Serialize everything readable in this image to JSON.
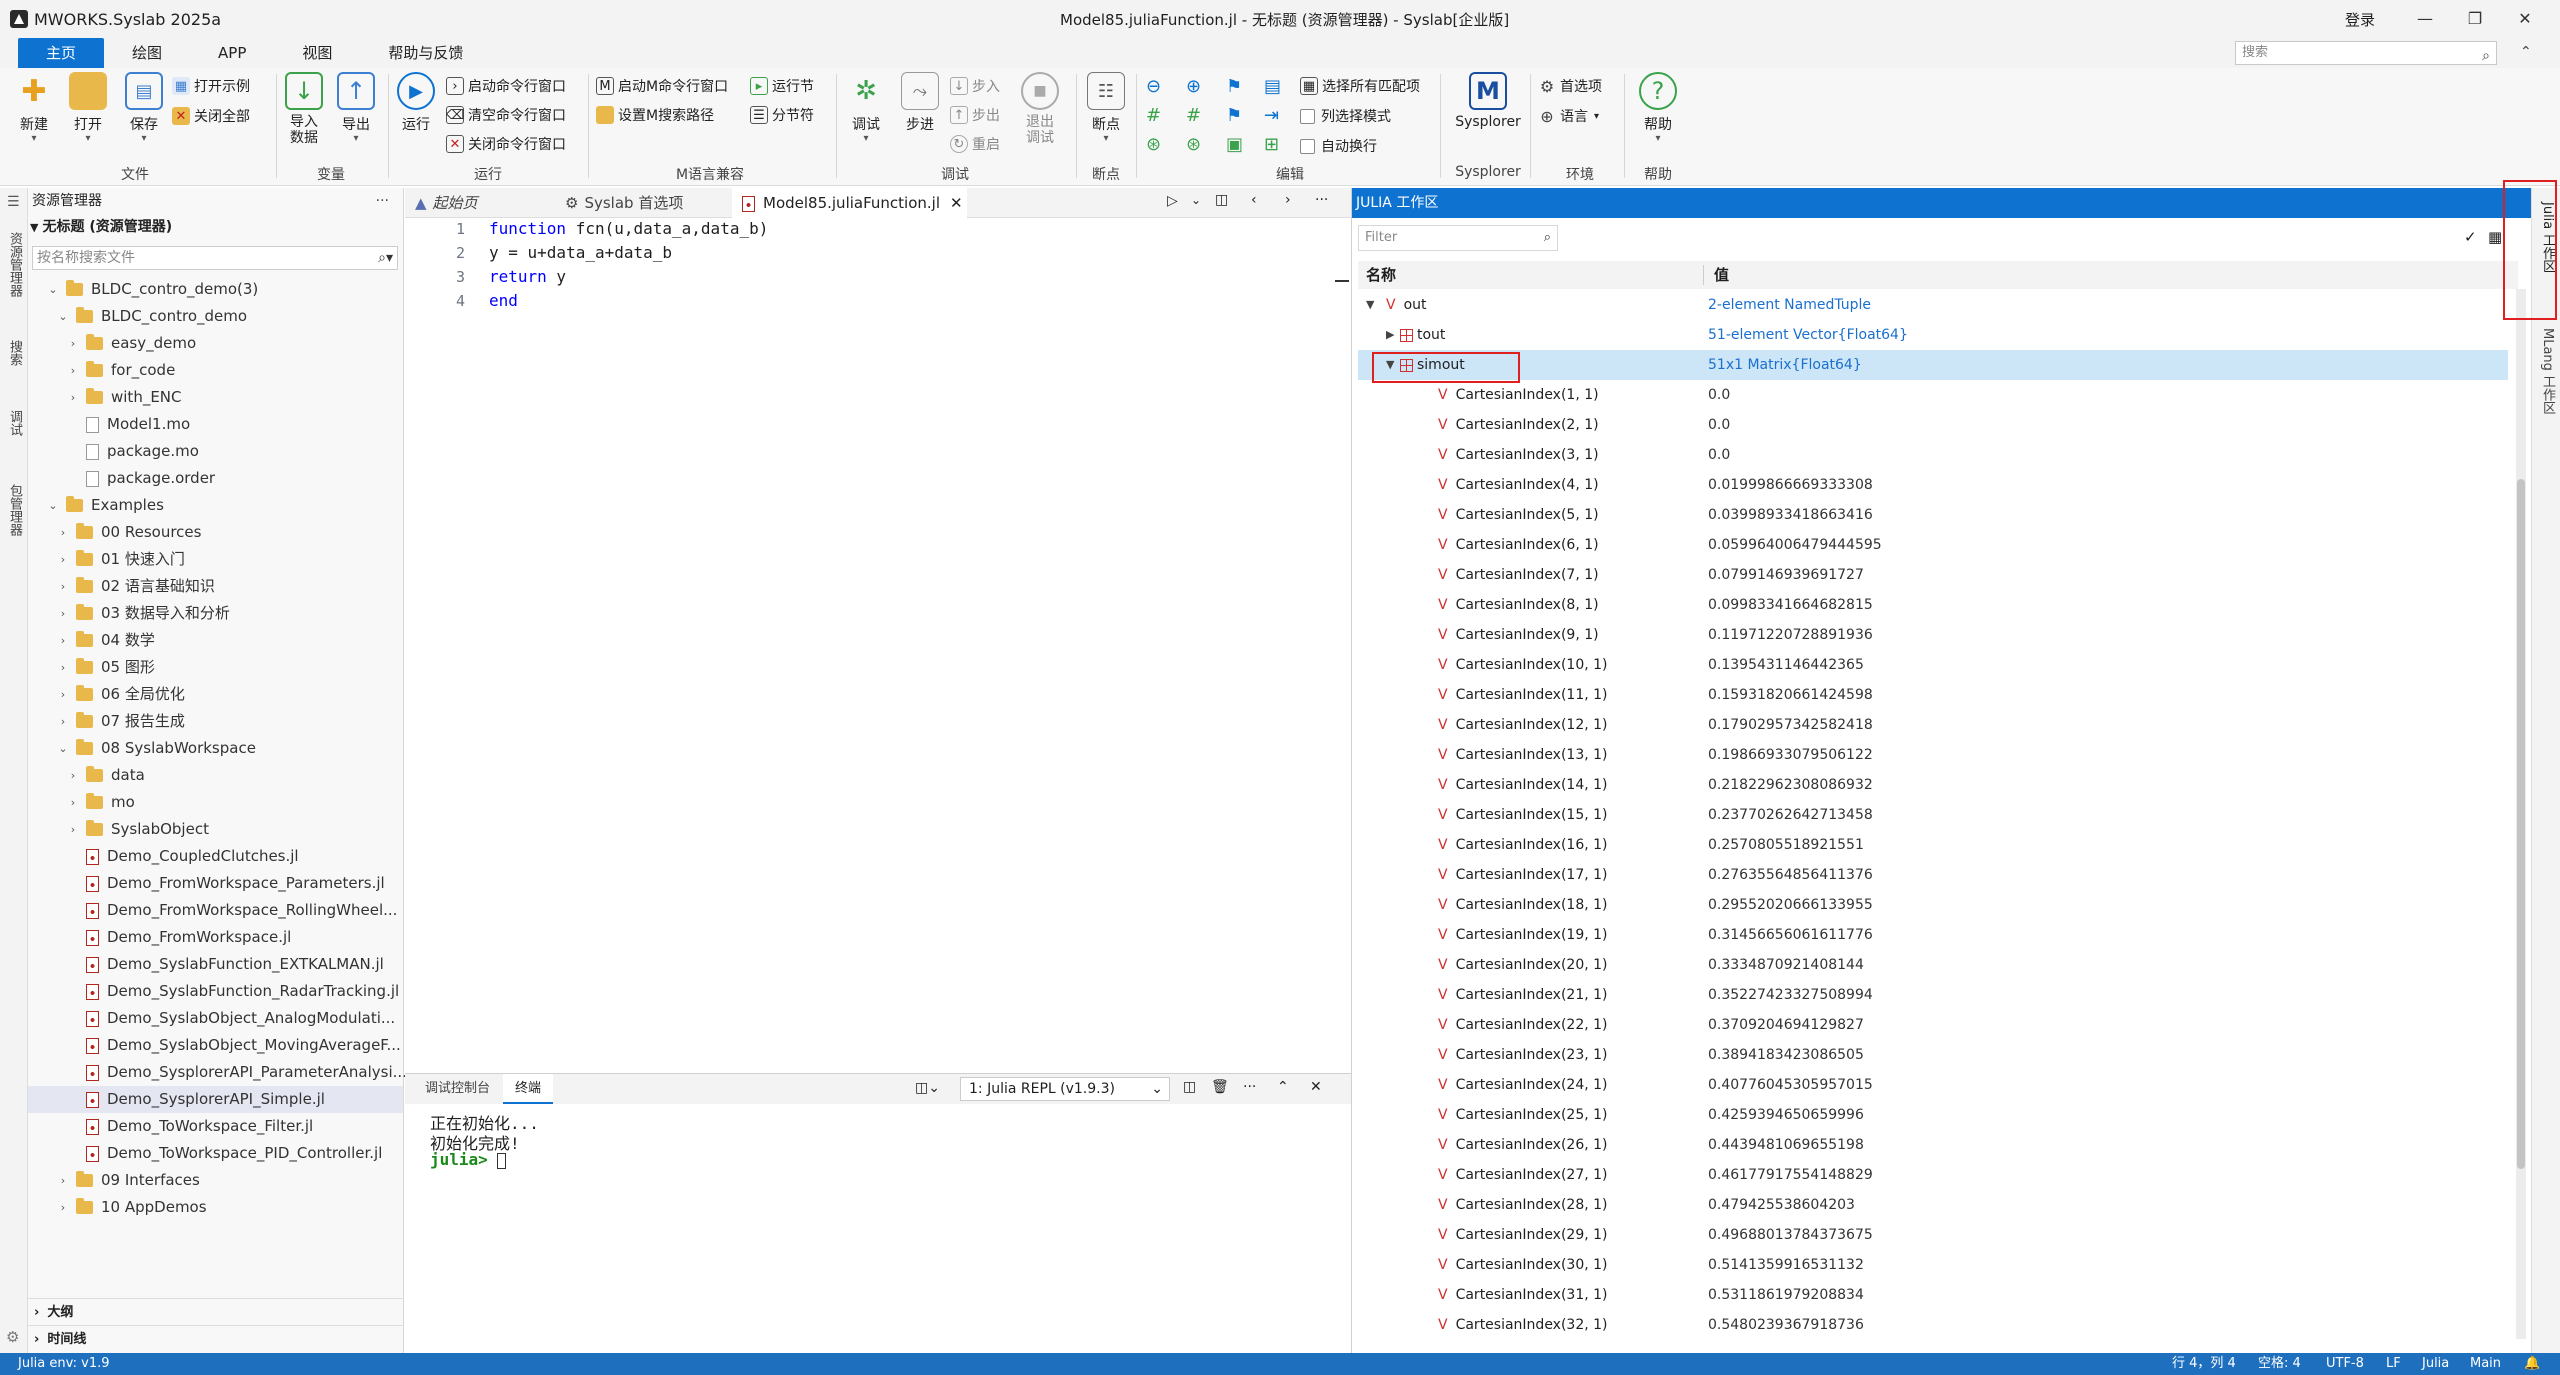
{
  "app": {
    "name": "MWORKS.Syslab 2025a",
    "title": "Model85.juliaFunction.jl - 无标题 (资源管理器) - Syslab[企业版]",
    "login": "登录",
    "search_placeholder": "搜索"
  },
  "menu_tabs": [
    "主页",
    "绘图",
    "APP",
    "视图",
    "帮助与反馈"
  ],
  "ribbon": {
    "new": "新建",
    "open": "打开",
    "save": "保存",
    "open_example": "打开示例",
    "close_all": "关闭全部",
    "import_data": "导入\n数据",
    "export_data": "导出",
    "run": "运行",
    "start_cmd": "启动命令行窗口",
    "clear_cmd": "清空命令行窗口",
    "close_cmd": "关闭命令行窗口",
    "start_m_cmd": "启动M命令行窗口",
    "set_m_path": "设置M搜索路径",
    "run_section": "运行节",
    "section_break": "分节符",
    "debug": "调试",
    "step": "步进",
    "step_in": "步入",
    "step_out": "步出",
    "restart": "重启",
    "exit_debug": "退出\n调试",
    "breakpoints": "断点",
    "select_all_match": "选择所有匹配项",
    "column_select": "列选择模式",
    "auto_wrap": "自动换行",
    "sysplorer": "Sysplorer",
    "preferences": "首选项",
    "language": "语言",
    "help": "帮助",
    "groups": {
      "file": "文件",
      "variable": "变量",
      "run": "运行",
      "m_compat": "M语言兼容",
      "debug": "调试",
      "breakpoints": "断点",
      "edit": "编辑",
      "sysplorer": "Sysplorer",
      "env": "环境",
      "help": "帮助"
    }
  },
  "activity": [
    "资源管理器",
    "搜索",
    "调试",
    "包管理器"
  ],
  "explorer": {
    "title": "资源管理器",
    "workspace": "无标题 (资源管理器)",
    "search_placeholder": "按名称搜索文件",
    "tree": [
      "BLDC_contro_demo(3)",
      "BLDC_contro_demo",
      "easy_demo",
      "for_code",
      "with_ENC",
      "Model1.mo",
      "package.mo",
      "package.order",
      "Examples",
      "00 Resources",
      "01 快速入门",
      "02 语言基础知识",
      "03 数据导入和分析",
      "04 数学",
      "05 图形",
      "06 全局优化",
      "07 报告生成",
      "08 SyslabWorkspace",
      "data",
      "mo",
      "SyslabObject",
      "Demo_CoupledClutches.jl",
      "Demo_FromWorkspace_Parameters.jl",
      "Demo_FromWorkspace_RollingWheel...",
      "Demo_FromWorkspace.jl",
      "Demo_SyslabFunction_EXTKALMAN.jl",
      "Demo_SyslabFunction_RadarTracking.jl",
      "Demo_SyslabObject_AnalogModulati...",
      "Demo_SyslabObject_MovingAverageF...",
      "Demo_SysplorerAPI_ParameterAnalysi...",
      "Demo_SysplorerAPI_Simple.jl",
      "Demo_ToWorkspace_Filter.jl",
      "Demo_ToWorkspace_PID_Controller.jl",
      "09 Interfaces",
      "10 AppDemos"
    ],
    "outline": "大纲",
    "timeline": "时间线"
  },
  "editor": {
    "tabs": [
      "起始页",
      "Syslab 首选项",
      "Model85.juliaFunction.jl"
    ],
    "lines": [
      {
        "n": "1",
        "kw": "function",
        "rest": " fcn(u,data_a,data_b)"
      },
      {
        "n": "2",
        "kw": "",
        "rest": "y = u+data_a+data_b"
      },
      {
        "n": "3",
        "kw": "return",
        "rest": " y"
      },
      {
        "n": "4",
        "kw": "end",
        "rest": ""
      }
    ]
  },
  "terminal": {
    "tabs": [
      "调试控制台",
      "终端"
    ],
    "repl": "1: Julia REPL (v1.9.3)",
    "lines": [
      "正在初始化...",
      "初始化完成!",
      "julia>"
    ]
  },
  "workspace": {
    "title": "JULIA 工作区",
    "filter_placeholder": "Filter",
    "col_name": "名称",
    "col_value": "值",
    "rows": [
      {
        "name": "out",
        "value": "2-element NamedTuple",
        "link": true
      },
      {
        "name": "tout",
        "value": "51-element Vector{Float64}",
        "link": true
      },
      {
        "name": "simout",
        "value": "51x1 Matrix{Float64}",
        "link": true
      }
    ],
    "cells": [
      {
        "name": "CartesianIndex(1, 1)",
        "value": "0.0"
      },
      {
        "name": "CartesianIndex(2, 1)",
        "value": "0.0"
      },
      {
        "name": "CartesianIndex(3, 1)",
        "value": "0.0"
      },
      {
        "name": "CartesianIndex(4, 1)",
        "value": "0.01999866669333308"
      },
      {
        "name": "CartesianIndex(5, 1)",
        "value": "0.03998933418663416"
      },
      {
        "name": "CartesianIndex(6, 1)",
        "value": "0.059964006479444595"
      },
      {
        "name": "CartesianIndex(7, 1)",
        "value": "0.0799146939691727"
      },
      {
        "name": "CartesianIndex(8, 1)",
        "value": "0.09983341664682815"
      },
      {
        "name": "CartesianIndex(9, 1)",
        "value": "0.11971220728891936"
      },
      {
        "name": "CartesianIndex(10, 1)",
        "value": "0.1395431146442365"
      },
      {
        "name": "CartesianIndex(11, 1)",
        "value": "0.15931820661424598"
      },
      {
        "name": "CartesianIndex(12, 1)",
        "value": "0.17902957342582418"
      },
      {
        "name": "CartesianIndex(13, 1)",
        "value": "0.19866933079506122"
      },
      {
        "name": "CartesianIndex(14, 1)",
        "value": "0.21822962308086932"
      },
      {
        "name": "CartesianIndex(15, 1)",
        "value": "0.23770262642713458"
      },
      {
        "name": "CartesianIndex(16, 1)",
        "value": "0.2570805518921551"
      },
      {
        "name": "CartesianIndex(17, 1)",
        "value": "0.27635564856411376"
      },
      {
        "name": "CartesianIndex(18, 1)",
        "value": "0.29552020666133955"
      },
      {
        "name": "CartesianIndex(19, 1)",
        "value": "0.31456656061611776"
      },
      {
        "name": "CartesianIndex(20, 1)",
        "value": "0.3334870921408144"
      },
      {
        "name": "CartesianIndex(21, 1)",
        "value": "0.35227423327508994"
      },
      {
        "name": "CartesianIndex(22, 1)",
        "value": "0.3709204694129827"
      },
      {
        "name": "CartesianIndex(23, 1)",
        "value": "0.3894183423086505"
      },
      {
        "name": "CartesianIndex(24, 1)",
        "value": "0.40776045305957015"
      },
      {
        "name": "CartesianIndex(25, 1)",
        "value": "0.4259394650659996"
      },
      {
        "name": "CartesianIndex(26, 1)",
        "value": "0.4439481069655198"
      },
      {
        "name": "CartesianIndex(27, 1)",
        "value": "0.46177917554148829"
      },
      {
        "name": "CartesianIndex(28, 1)",
        "value": "0.479425538604203"
      },
      {
        "name": "CartesianIndex(29, 1)",
        "value": "0.49688013784373675"
      },
      {
        "name": "CartesianIndex(30, 1)",
        "value": "0.5141359916531132"
      },
      {
        "name": "CartesianIndex(31, 1)",
        "value": "0.5311861979208834"
      },
      {
        "name": "CartesianIndex(32, 1)",
        "value": "0.5480239367918736"
      }
    ]
  },
  "rightbar": [
    "Julia 工作区",
    "MLang 工作区"
  ],
  "status": {
    "env": "Julia env: v1.9",
    "pos": "行 4，列 4",
    "spaces": "空格: 4",
    "encoding": "UTF-8",
    "eol": "LF",
    "lang": "Julia",
    "branch": "Main"
  },
  "colors": {
    "accent": "#0e72d1",
    "status": "#1f6fbf",
    "value_link": "#1a6fcf",
    "var_marker": "#d03030",
    "annotation": "#e02020"
  }
}
